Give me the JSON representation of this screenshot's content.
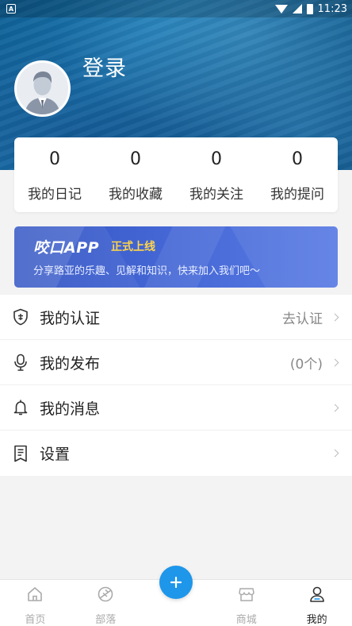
{
  "status_bar": {
    "indicator": "A",
    "time": "11:23"
  },
  "profile": {
    "login_text": "登录"
  },
  "stats": [
    {
      "value": "0",
      "label": "我的日记"
    },
    {
      "value": "0",
      "label": "我的收藏"
    },
    {
      "value": "0",
      "label": "我的关注"
    },
    {
      "value": "0",
      "label": "我的提问"
    }
  ],
  "banner": {
    "title": "咬口APP",
    "badge": "正式上线",
    "subtitle": "分享路亚的乐趣、见解和知识，快来加入我们吧～"
  },
  "menu": [
    {
      "label": "我的认证",
      "value": "去认证",
      "icon": "shield-icon"
    },
    {
      "label": "我的发布",
      "value": "(0个)",
      "icon": "microphone-icon"
    },
    {
      "label": "我的消息",
      "value": "",
      "icon": "bell-icon"
    },
    {
      "label": "设置",
      "value": "",
      "icon": "settings-doc-icon"
    }
  ],
  "tabs": [
    {
      "label": "首页",
      "icon": "home-icon",
      "active": false
    },
    {
      "label": "部落",
      "icon": "tribe-icon",
      "active": false
    },
    {
      "label": "商城",
      "icon": "store-icon",
      "active": false
    },
    {
      "label": "我的",
      "icon": "user-icon",
      "active": true
    }
  ],
  "colors": {
    "accent": "#1e96ea",
    "banner_badge": "#ffd54a"
  }
}
